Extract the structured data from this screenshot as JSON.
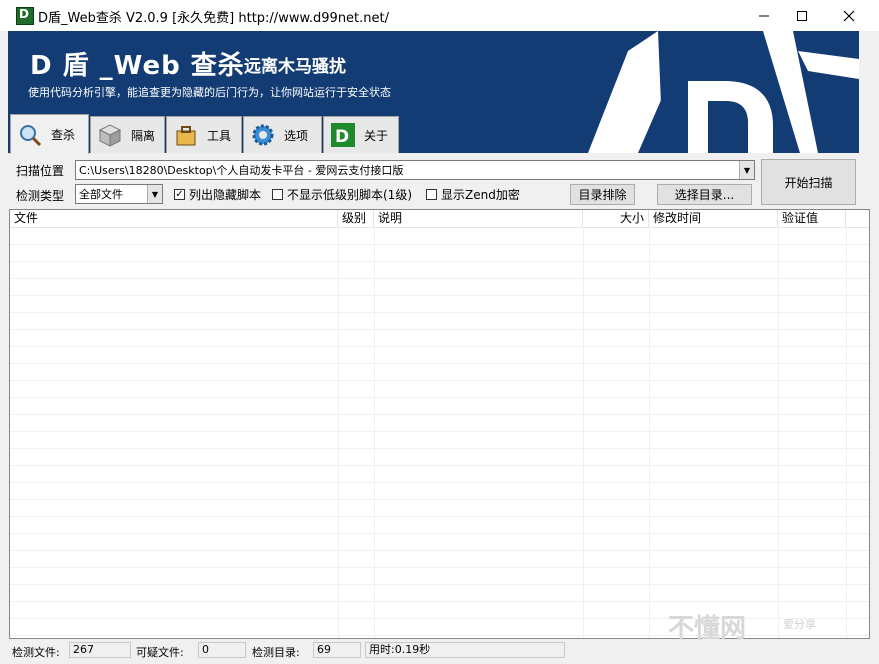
{
  "window": {
    "title": "D盾_Web查杀 V2.0.9 [永久免费] http://www.d99net.net/"
  },
  "banner": {
    "title": "D 盾 _Web 查杀",
    "slogan": "远离木马骚扰",
    "subtitle": "使用代码分析引擎，能追查更为隐藏的后门行为，让你网站运行于安全状态"
  },
  "tabs": [
    {
      "label": "查杀",
      "icon": "magnifier-icon"
    },
    {
      "label": "隔离",
      "icon": "box-icon"
    },
    {
      "label": "工具",
      "icon": "toolbox-icon"
    },
    {
      "label": "选项",
      "icon": "gear-icon"
    },
    {
      "label": "关于",
      "icon": "d-logo-icon"
    }
  ],
  "scan": {
    "location_label": "扫描位置",
    "location_value": "C:\\Users\\18280\\Desktop\\个人自动发卡平台 - 爱网云支付接口版",
    "type_label": "检测类型",
    "type_value": "全部文件",
    "opt_hidden": "列出隐藏脚本",
    "opt_hidden_checked": true,
    "opt_lowlevel": "不显示低级别脚本(1级)",
    "opt_lowlevel_checked": false,
    "opt_zend": "显示Zend加密",
    "opt_zend_checked": false,
    "exclude_btn": "目录排除",
    "select_dir_btn": "选择目录...",
    "start_btn": "开始扫描"
  },
  "list": {
    "columns": [
      "文件",
      "级别",
      "说明",
      "大小",
      "修改时间",
      "验证值"
    ]
  },
  "status": {
    "files_label": "检测文件:",
    "files_value": "267",
    "suspicious_label": "可疑文件:",
    "suspicious_value": "0",
    "dirs_label": "检测目录:",
    "dirs_value": "69",
    "time_text": "用时:0.19秒"
  },
  "watermark": {
    "main": "不懂网",
    "sub": "爱分享"
  },
  "colors": {
    "banner": "#133c74",
    "window": "#f0f0f0"
  }
}
